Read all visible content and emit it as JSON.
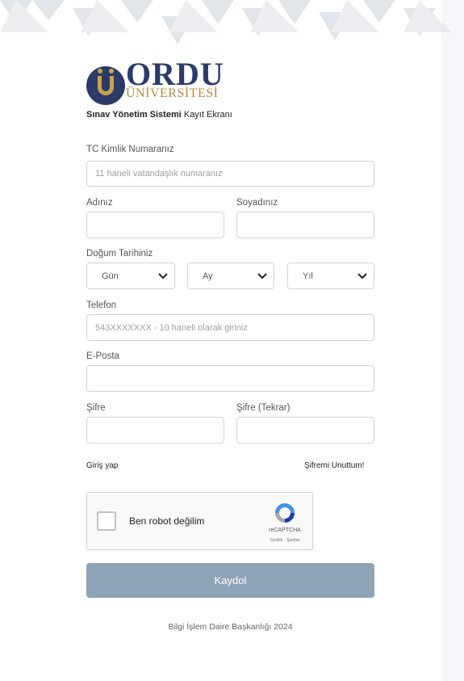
{
  "header": {
    "logo_main": "ORDU",
    "logo_sub": "ÜNİVERSİTESİ",
    "subtitle_bold": "Sınav Yönetim Sistemi",
    "subtitle_rest": " Kayıt Ekranı"
  },
  "form": {
    "tc_label": "TC Kimlik Numaranız",
    "tc_placeholder": "11 haneli vatandaşlık numaranız",
    "name_label": "Adınız",
    "surname_label": "Soyadınız",
    "birth_label": "Doğum Tarihiniz",
    "day_selected": "Gün",
    "month_selected": "Ay",
    "year_selected": "Yıl",
    "phone_label": "Telefon",
    "phone_placeholder": "543XXXXXXX - 10 haneli olarak giriniz",
    "email_label": "E-Posta",
    "password_label": "Şifre",
    "password2_label": "Şifre (Tekrar)",
    "login_link": "Giriş yap",
    "forgot_link": "Şifremi Unuttum!",
    "submit_label": "Kaydol"
  },
  "captcha": {
    "text": "Ben robot değilim",
    "brand": "reCAPTCHA",
    "links": "Gizlilik - Şartlar"
  },
  "footer": {
    "text": "Bilgi İşlem Daire Başkanlığı 2024"
  },
  "colors": {
    "brand_navy": "#2b3a68",
    "brand_gold": "#b48b3c",
    "button_bg": "#8fa3b7"
  }
}
